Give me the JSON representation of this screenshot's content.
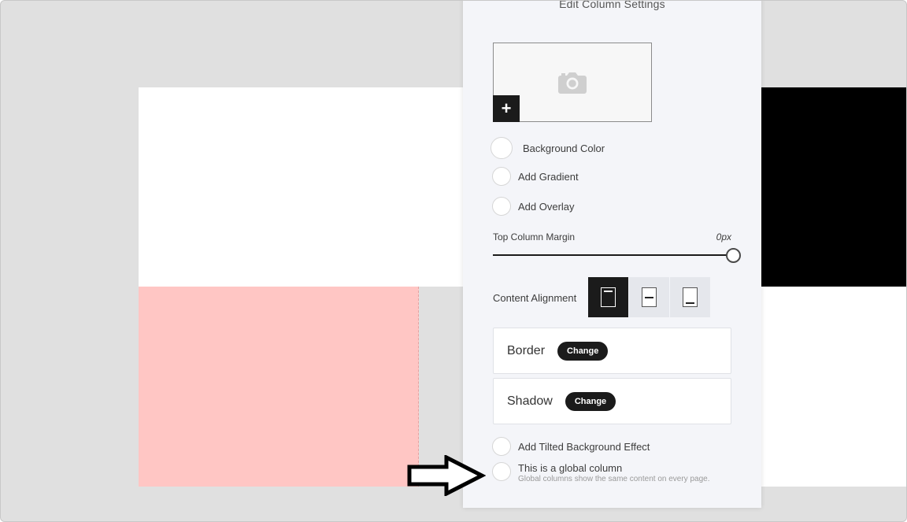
{
  "panel": {
    "title": "Edit Column Settings",
    "add_image_symbol": "+",
    "background_color_label": "Background Color",
    "gradient_label": "Add Gradient",
    "overlay_label": "Add Overlay",
    "margin": {
      "label": "Top Column Margin",
      "value": "0px",
      "slider_fraction": 1.0
    },
    "content_alignment": {
      "label": "Content Alignment",
      "options": [
        "top",
        "middle",
        "bottom"
      ],
      "selected": "top"
    },
    "border": {
      "label": "Border",
      "button": "Change"
    },
    "shadow": {
      "label": "Shadow",
      "button": "Change"
    },
    "tilted_label": "Add Tilted Background Effect",
    "global": {
      "label": "This is a global column",
      "description": "Global columns show the same content on every page."
    }
  },
  "icons": {
    "image_placeholder": "camera-icon",
    "pointer": "right-arrow-icon"
  },
  "colors": {
    "canvas_bg": "#e0e0e0",
    "panel_bg": "#f4f5f9",
    "pink_block": "#ffc6c4",
    "accent_dark": "#1b1b1b"
  }
}
